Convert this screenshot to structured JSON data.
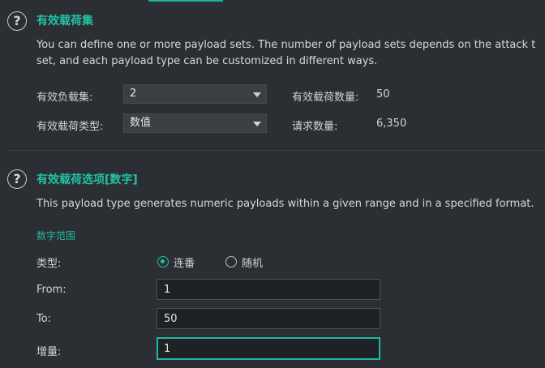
{
  "payload_sets": {
    "title": "有效载荷集",
    "description_line1": "You can define one or more payload sets. The number of payload sets depends on the attack t",
    "description_line2": "set, and each payload type can be customized in different ways.",
    "set_label": "有效负载集:",
    "set_value": "2",
    "type_label": "有效载荷类型:",
    "type_value": "数值",
    "count_label": "有效载荷数量:",
    "count_value": "50",
    "request_label": "请求数量:",
    "request_value": "6,350"
  },
  "payload_options": {
    "title": "有效载荷选项[数字]",
    "description": "This payload type generates numeric payloads within a given range and in a specified format.",
    "range_heading": "数字范围",
    "type_label": "类型:",
    "radio_sequential": "连番",
    "radio_random": "随机",
    "selected_radio": "sequential",
    "from_label": "From:",
    "from_value": "1",
    "to_label": "To:",
    "to_value": "50",
    "step_label": "增量:",
    "step_value": "1"
  },
  "colors": {
    "accent": "#22c3a6",
    "background": "#2b2f33",
    "input_background": "#1f2225"
  },
  "icons": {
    "help": "?"
  }
}
